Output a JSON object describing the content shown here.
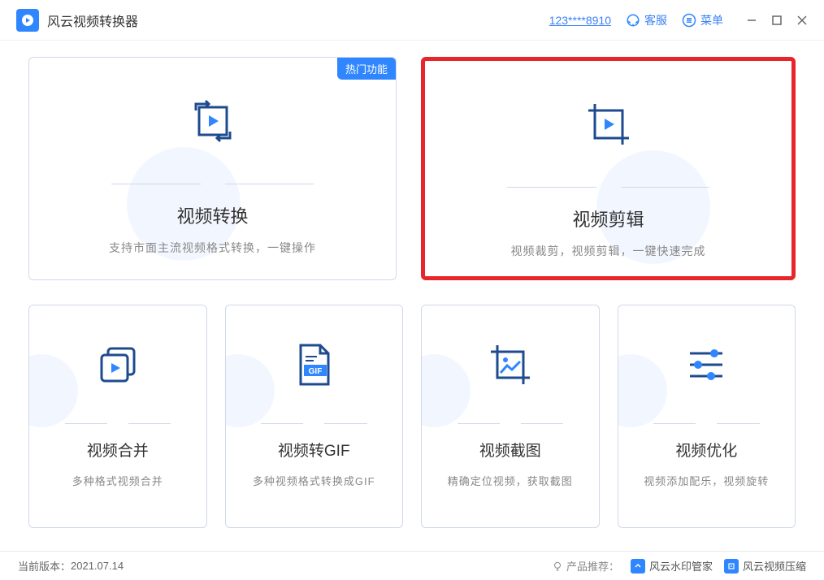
{
  "app": {
    "title": "风云视频转换器"
  },
  "titlebar": {
    "phone": "123****8910",
    "support": "客服",
    "menu": "菜单"
  },
  "hot_badge": "热门功能",
  "cards": {
    "convert": {
      "title": "视频转换",
      "desc": "支持市面主流视频格式转换，一键操作"
    },
    "edit": {
      "title": "视频剪辑",
      "desc": "视频裁剪，视频剪辑，一键快速完成"
    },
    "merge": {
      "title": "视频合并",
      "desc": "多种格式视频合并"
    },
    "gif": {
      "title": "视频转GIF",
      "desc": "多种视频格式转换成GIF",
      "badge": "GIF"
    },
    "screenshot": {
      "title": "视频截图",
      "desc": "精确定位视频，获取截图"
    },
    "optimize": {
      "title": "视频优化",
      "desc": "视频添加配乐，视频旋转"
    }
  },
  "footer": {
    "version_label": "当前版本：",
    "version": "2021.07.14",
    "recommend_label": "产品推荐：",
    "product1": "风云水印管家",
    "product2": "风云视频压缩"
  }
}
